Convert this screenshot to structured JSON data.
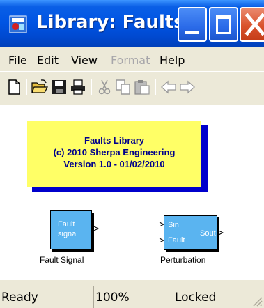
{
  "window": {
    "title": "Library: Faults...",
    "buttons": {
      "minimize": "minimize",
      "maximize": "maximize",
      "close": "close"
    }
  },
  "menu": {
    "items": [
      {
        "label": "File",
        "enabled": true
      },
      {
        "label": "Edit",
        "enabled": true
      },
      {
        "label": "View",
        "enabled": true
      },
      {
        "label": "Format",
        "enabled": false
      },
      {
        "label": "Help",
        "enabled": true
      }
    ]
  },
  "toolbar": {
    "icons": [
      "new-file-icon",
      "open-folder-icon",
      "save-icon",
      "print-icon",
      "cut-icon",
      "copy-icon",
      "paste-icon",
      "back-arrow-icon",
      "forward-arrow-icon"
    ]
  },
  "annotation": {
    "line1": "Faults Library",
    "line2": "(c) 2010 Sherpa Engineering",
    "line3": "Version 1.0 - 01/02/2010"
  },
  "blocks": {
    "fault_signal": {
      "line1": "Fault",
      "line2": "signal",
      "caption": "Fault Signal"
    },
    "perturbation": {
      "in1": "Sin",
      "in2": "Fault",
      "out": "Sout",
      "caption": "Perturbation"
    }
  },
  "status": {
    "state": "Ready",
    "zoom": "100%",
    "lock": "Locked"
  },
  "colors": {
    "titlebar": "#0054e3",
    "annotation_bg": "#ffff66",
    "annotation_text": "#00008b",
    "block_fill": "#5ab4f0"
  }
}
